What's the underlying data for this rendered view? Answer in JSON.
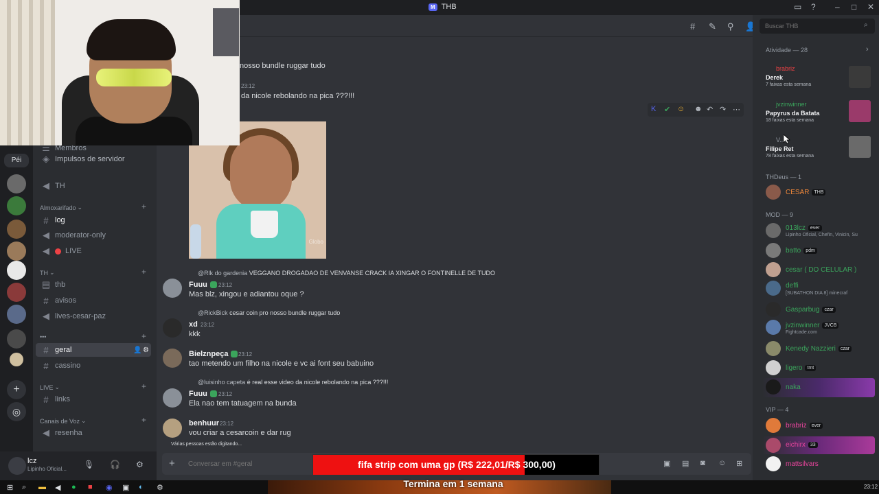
{
  "titlebar": {
    "workspace_badge": "M",
    "title": "THB"
  },
  "server_rail": {
    "home_label": "Péi"
  },
  "channels": {
    "partial_top": "Membros",
    "boost": "Impulsos de servidor",
    "th_channel": "TH",
    "categories": {
      "almox": "Almoxarifado",
      "th": "TH",
      "emoji": "•••",
      "live": "LIVE",
      "voice": "Canais de Voz"
    },
    "items": {
      "log": "log",
      "moderator_only": "moderator-only",
      "live": "LIVE",
      "thb": "thb",
      "avisos": "avisos",
      "lives_cesar_paz": "lives-cesar-paz",
      "geral": "geral",
      "cassino": "cassino",
      "links": "links",
      "resenha": "resenha"
    }
  },
  "user": {
    "name": "lcz",
    "status": "Lipinho Oficial..."
  },
  "chat": {
    "partial_msg_1": "nosso bundle ruggar tudo",
    "partial_time": "23:12",
    "partial_msg_2": "da nicole rebolando na pica ???!!!",
    "gif_watermark": "Globo",
    "messages": [
      {
        "reply_user": "@Rlk do gardenia",
        "reply_text": "VEGGANO DROGADAO DE VENVANSE CRACK IA XINGAR O FONTINELLE DE TUDO",
        "author": "Fuuu",
        "time": "23:12",
        "text": "Mas blz, xingou e adiantou oque ?"
      },
      {
        "reply_user": "@RickBick",
        "reply_text": "cesar coin pro nosso bundle ruggar tudo",
        "author": "xd",
        "time": "23:12",
        "text": "kkk"
      },
      {
        "author": "Bielznpeça",
        "time": "23:12",
        "text": "tao metendo um filho na nicole e vc ai font seu babuino"
      },
      {
        "reply_user": "@luisinho capeta",
        "reply_text": "é real esse video da nicole rebolando na pica ???!!!",
        "author": "Fuuu",
        "time": "23:12",
        "text": "Ela nao tem tatuagem na bunda"
      },
      {
        "author": "benhuur",
        "time": "23:12",
        "text": "vou criar a cesarcoin e dar rug"
      }
    ],
    "typing": "Várias pessoas estão digitando...",
    "input_placeholder": "Conversar em #geral"
  },
  "overlay": {
    "goal_text": "fifa strip com uma gp (R$ 222,01/R$ 300,00)",
    "goal_progress": 0.74,
    "goal_subtext": "Termina em 1 semana",
    "colors": {
      "fill": "#ee1111",
      "empty": "#000000"
    }
  },
  "members": {
    "search_placeholder": "Buscar THB",
    "activity_header": "Atividade — 28",
    "activity": [
      {
        "user": "brabriz",
        "title": "Derek",
        "sub": "7 faixas esta semana"
      },
      {
        "user": "jvzinwinner",
        "title": "Papyrus da Batata",
        "sub": "18 faixas esta semana"
      },
      {
        "user": "V...a",
        "title": "Filipe Ret",
        "sub": "78 faixas esta semana"
      }
    ],
    "groups": [
      {
        "header": "THDeus — 1",
        "members": [
          {
            "name": "CESAR",
            "tag": "THB",
            "color": "#f0883a"
          }
        ]
      },
      {
        "header": "MOD — 9",
        "members": [
          {
            "name": "013lcz",
            "tag": "ever",
            "sub": "Lipinho Oficial, Chefin, Vinicin, Su",
            "color": "#3ba55c"
          },
          {
            "name": "batto",
            "tag": "pdm",
            "color": "#3ba55c"
          },
          {
            "name": "cesar ( DO CELULAR )",
            "color": "#3ba55c"
          },
          {
            "name": "deffi",
            "sub": "[SUBATHON DIA 8] minecraf",
            "color": "#3ba55c"
          },
          {
            "name": "Gasparbug",
            "tag": "czar",
            "color": "#3ba55c"
          },
          {
            "name": "jvzinwinner",
            "tag": "JVCB",
            "sub": "Fightcade.com",
            "color": "#3ba55c"
          },
          {
            "name": "Kenedy Nazzieri",
            "tag": "czar",
            "color": "#3ba55c"
          },
          {
            "name": "ligero",
            "tag": "tmt",
            "color": "#3ba55c"
          },
          {
            "name": "naka",
            "color": "#3ba55c"
          }
        ]
      },
      {
        "header": "VIP — 4",
        "members": [
          {
            "name": "brabriz",
            "tag": "ever",
            "color": "#eb459e"
          },
          {
            "name": "eichirx",
            "tag": "33",
            "color": "#eb459e"
          },
          {
            "name": "mattsilvars",
            "color": "#eb459e"
          }
        ]
      }
    ]
  },
  "taskbar": {
    "clock": "23:12"
  }
}
